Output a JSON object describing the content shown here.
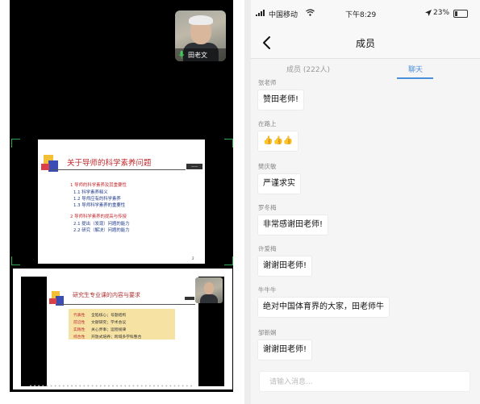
{
  "meeting": {
    "participant_name": "田老文",
    "slide1": {
      "title": "关于导师的科学素养问题",
      "tag": "——",
      "lines": [
        "1 导师的科学素养及其重要性",
        "1.1 科学素养释义",
        "1.2 导师应有的科学素养",
        "1.3 导师科学素养的重要性",
        "2 导师科学素养的提高与传授",
        "2.1 提出（发现）问题的能力",
        "2.2 研究（解决）问题的能力"
      ],
      "page_number": "2"
    },
    "slide2": {
      "title": "研究生专业课的内容与要求",
      "rows": [
        {
          "k": "代表性",
          "v": "全陷核心；号题结构"
        },
        {
          "k": "前沿性",
          "v": "文献研究；学术会议"
        },
        {
          "k": "实践性",
          "v": "关心界事；运程规律"
        },
        {
          "k": "综合性",
          "v": "开放式培养；跨域多学科整合"
        }
      ]
    }
  },
  "status_bar": {
    "carrier": "中国移动",
    "time": "下午8:29",
    "battery": "23%",
    "battery_level": 0.23
  },
  "nav": {
    "back_icon": "chevron-left-icon",
    "title": "成员"
  },
  "tabs": [
    {
      "label": "成员 (222人)",
      "active": false
    },
    {
      "label": "聊天",
      "active": true
    }
  ],
  "messages": [
    {
      "sender": "张老师",
      "text": "赞田老师!"
    },
    {
      "sender": "在路上",
      "text": "👍👍👍"
    },
    {
      "sender": "樊庆敏",
      "text": "严谨求实"
    },
    {
      "sender": "罗冬梅",
      "text": "非常感谢田老师!"
    },
    {
      "sender": "许爱梅",
      "text": "谢谢田老师!"
    },
    {
      "sender": "牛牛牛",
      "text": "绝对中国体育界的大家，田老师牛"
    },
    {
      "sender": "邹新娴",
      "text": "谢谢田老师!"
    }
  ],
  "input": {
    "placeholder": "请输入消息..."
  },
  "colors": {
    "accent": "#4a8fd9",
    "frame_green": "#2fa84f",
    "slide_title_red": "#c0282d"
  }
}
